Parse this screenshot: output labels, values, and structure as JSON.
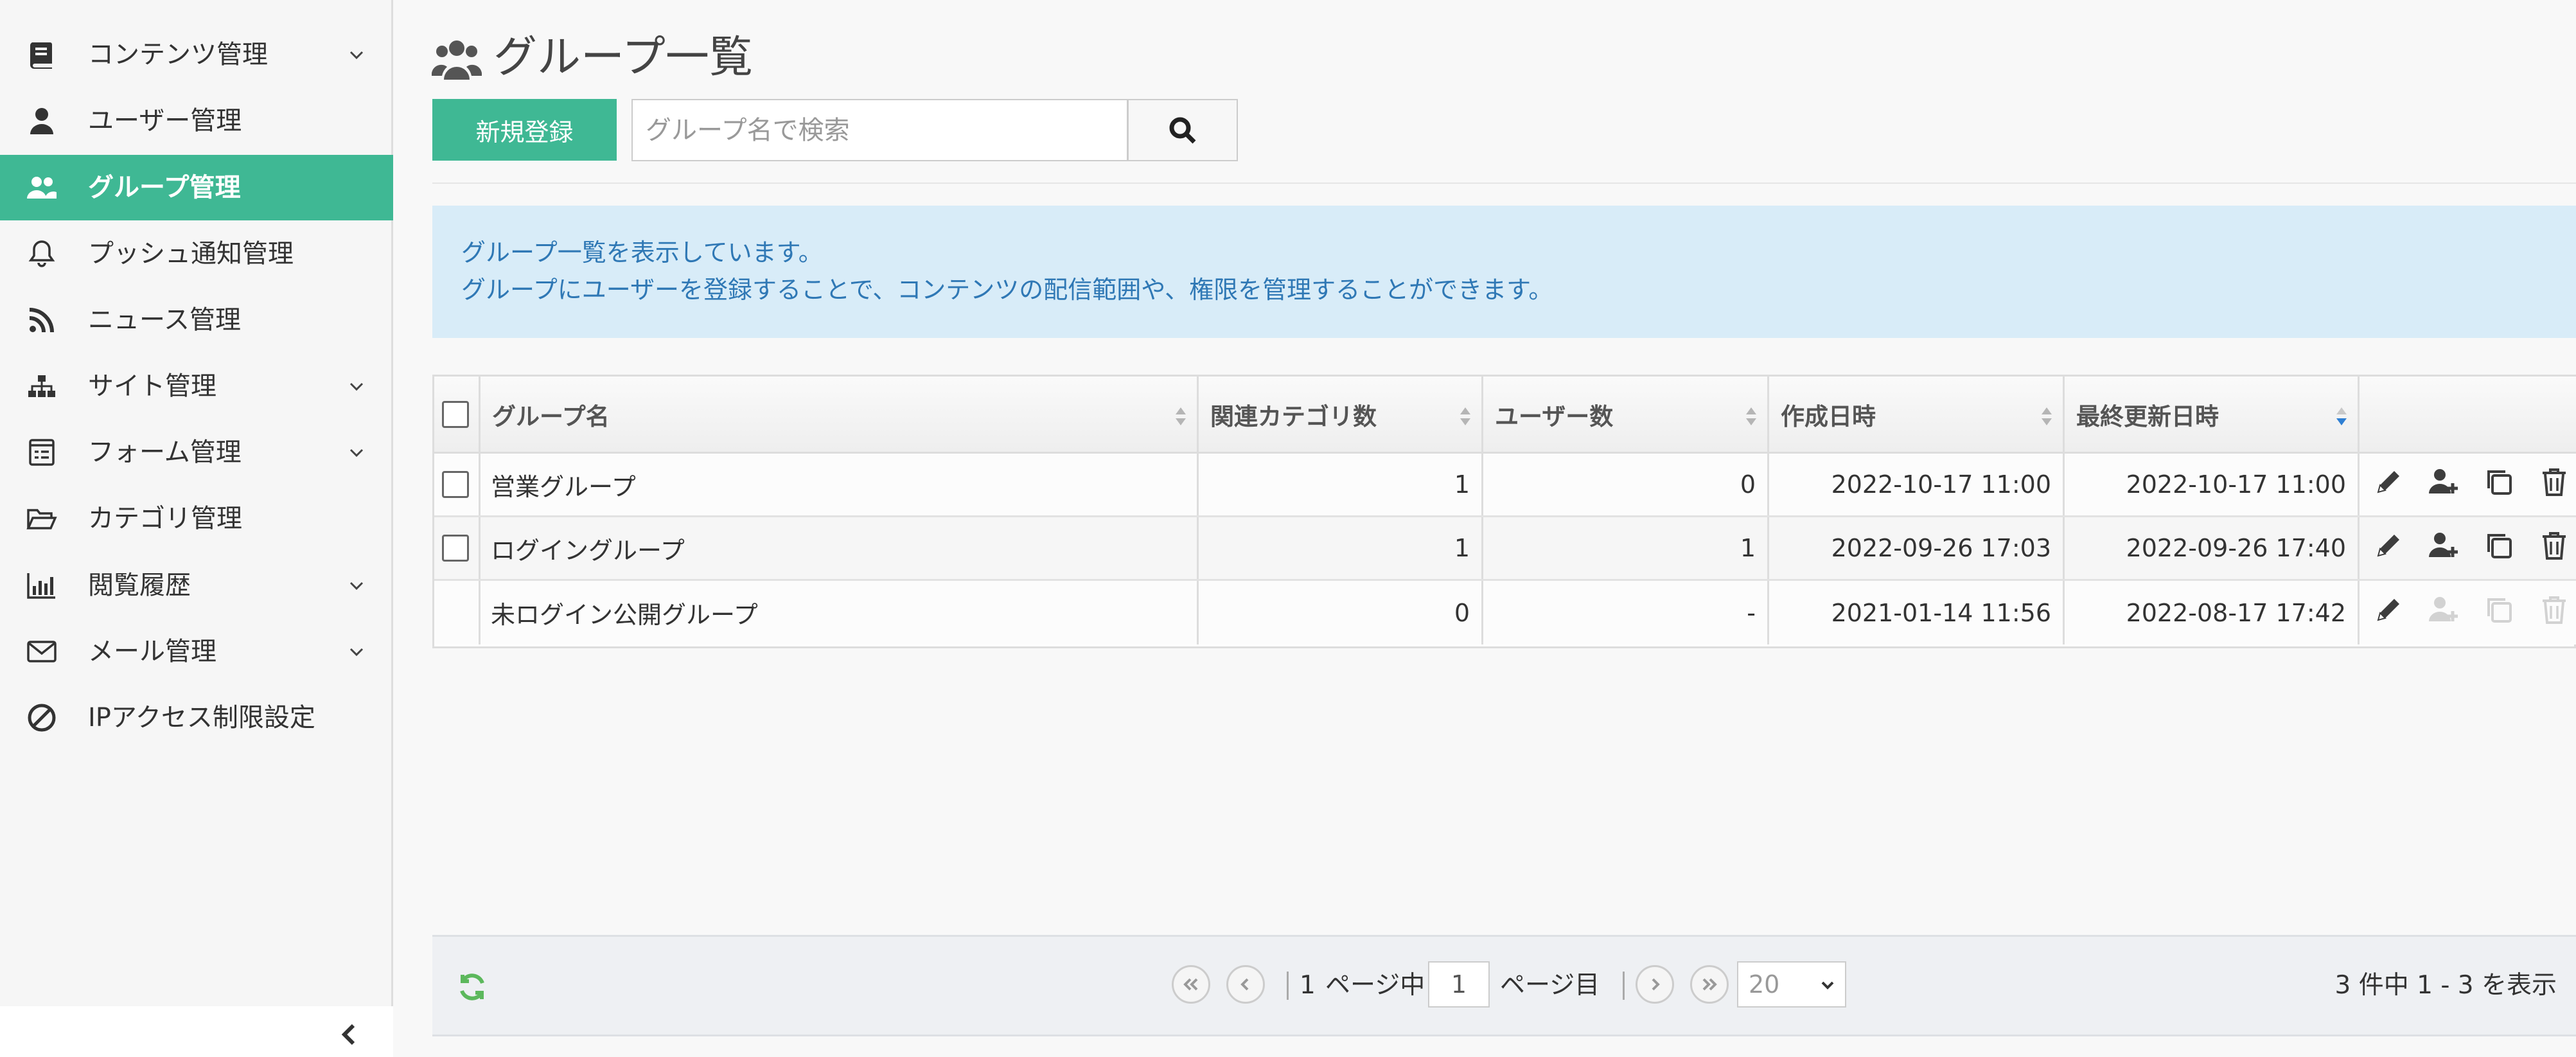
{
  "sidebar": {
    "items": [
      {
        "label": "コンテンツ管理",
        "icon": "book-icon",
        "has_submenu": true,
        "active": false
      },
      {
        "label": "ユーザー管理",
        "icon": "user-icon",
        "has_submenu": false,
        "active": false
      },
      {
        "label": "グループ管理",
        "icon": "users-icon",
        "has_submenu": false,
        "active": true
      },
      {
        "label": "プッシュ通知管理",
        "icon": "bell-icon",
        "has_submenu": false,
        "active": false
      },
      {
        "label": "ニュース管理",
        "icon": "rss-icon",
        "has_submenu": false,
        "active": false
      },
      {
        "label": "サイト管理",
        "icon": "sitemap-icon",
        "has_submenu": true,
        "active": false
      },
      {
        "label": "フォーム管理",
        "icon": "form-icon",
        "has_submenu": true,
        "active": false
      },
      {
        "label": "カテゴリ管理",
        "icon": "folder-open-icon",
        "has_submenu": false,
        "active": false
      },
      {
        "label": "閲覧履歴",
        "icon": "bar-chart-icon",
        "has_submenu": true,
        "active": false
      },
      {
        "label": "メール管理",
        "icon": "envelope-icon",
        "has_submenu": true,
        "active": false
      },
      {
        "label": "IPアクセス制限設定",
        "icon": "ban-icon",
        "has_submenu": false,
        "active": false
      }
    ]
  },
  "header": {
    "title": "グループ一覧",
    "title_icon": "users-icon"
  },
  "toolbar": {
    "new_label": "新規登録",
    "search_placeholder": "グループ名で検索",
    "search_value": ""
  },
  "info": {
    "line1": "グループ一覧を表示しています。",
    "line2": "グループにユーザーを登録することで、コンテンツの配信範囲や、権限を管理することができます。"
  },
  "table": {
    "columns": [
      "グループ名",
      "関連カテゴリ数",
      "ユーザー数",
      "作成日時",
      "最終更新日時"
    ],
    "sorted_column": "最終更新日時",
    "sort_direction": "desc",
    "rows": [
      {
        "name": "営業グループ",
        "category_count": "1",
        "user_count": "0",
        "created": "2022-10-17 11:00",
        "updated": "2022-10-17 11:00",
        "selectable": true,
        "actions_enabled": true
      },
      {
        "name": "ログイングループ",
        "category_count": "1",
        "user_count": "1",
        "created": "2022-09-26 17:03",
        "updated": "2022-09-26 17:40",
        "selectable": true,
        "actions_enabled": true
      },
      {
        "name": "未ログイン公開グループ",
        "category_count": "0",
        "user_count": "-",
        "created": "2021-01-14 11:56",
        "updated": "2022-08-17 17:42",
        "selectable": false,
        "actions_enabled": false
      }
    ]
  },
  "pager": {
    "total_pages": "1",
    "page_prefix": "ページ中",
    "current_page": "1",
    "page_suffix": "ページ目",
    "page_size": "20",
    "summary": "3 件中 1 - 3 を表示"
  },
  "colors": {
    "accent": "#3fb894",
    "info_bg": "#d8ecf8",
    "info_text": "#2f78b5",
    "refresh": "#5cb85c"
  }
}
